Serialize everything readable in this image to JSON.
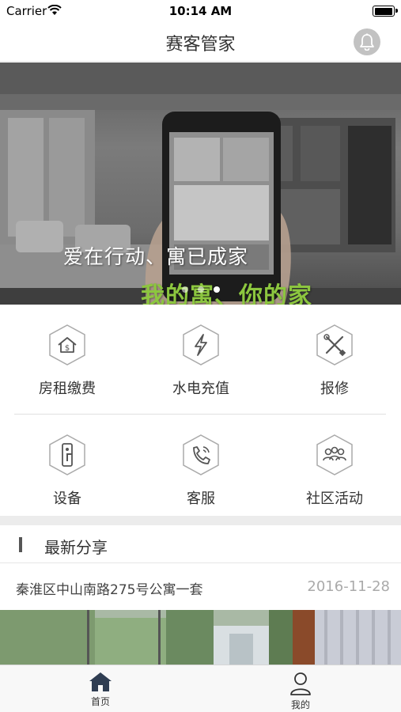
{
  "status_bar": {
    "carrier": "Carrier",
    "time": "10:14 AM"
  },
  "nav": {
    "title": "赛客管家",
    "bell_icon": "bell-icon"
  },
  "banner": {
    "slogan_line1": "爱在行动、寓已成家",
    "slogan_line2": "我的寓、你的家",
    "slide_count": 3,
    "active_slide": 3
  },
  "services": [
    {
      "label": "房租缴费",
      "icon": "house-dollar-icon"
    },
    {
      "label": "水电充值",
      "icon": "lightning-icon"
    },
    {
      "label": "报修",
      "icon": "tools-icon"
    },
    {
      "label": "设备",
      "icon": "door-lock-icon"
    },
    {
      "label": "客服",
      "icon": "phone-icon"
    },
    {
      "label": "社区活动",
      "icon": "group-icon"
    }
  ],
  "latest_share": {
    "title": "最新分享",
    "items": [
      {
        "title": "秦淮区中山南路275号公寓一套",
        "date": "2016-11-28"
      }
    ]
  },
  "tab_bar": {
    "tabs": [
      {
        "label": "首页",
        "icon": "home-icon",
        "active": true
      },
      {
        "label": "我的",
        "icon": "user-icon",
        "active": false
      }
    ]
  },
  "colors": {
    "accent_green": "#8cc63f",
    "icon_gray": "#555555",
    "bell_bg": "#c2c2c2"
  }
}
